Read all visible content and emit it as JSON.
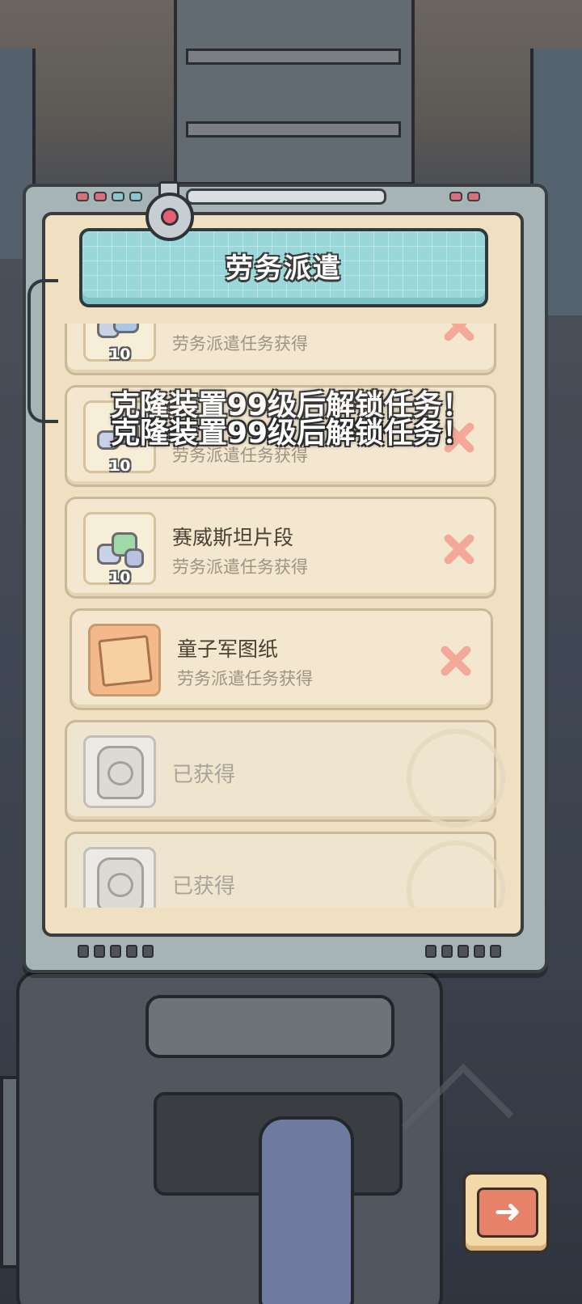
{
  "title": "劳务派遣",
  "notice": "克隆装置99级后解锁任务！",
  "items": [
    {
      "name": "",
      "source": "劳务派遣任务获得",
      "count": "10",
      "state": "unobtained"
    },
    {
      "name": "",
      "source": "劳务派遣任务获得",
      "count": "10",
      "state": "unobtained"
    },
    {
      "name": "赛威斯坦片段",
      "source": "劳务派遣任务获得",
      "count": "10",
      "state": "unobtained"
    },
    {
      "name": "童子军图纸",
      "source": "劳务派遣任务获得",
      "count": "",
      "state": "unobtained"
    },
    {
      "status": "已获得",
      "state": "obtained"
    },
    {
      "status": "已获得",
      "state": "obtained"
    }
  ],
  "colors": {
    "banner": "#9ad7d8",
    "panel_bg": "#efe0c2",
    "close_mark": "#f3a89a",
    "next_button": "#e6816a"
  },
  "icons": {
    "close": "close-icon",
    "next": "arrow-right-icon"
  }
}
